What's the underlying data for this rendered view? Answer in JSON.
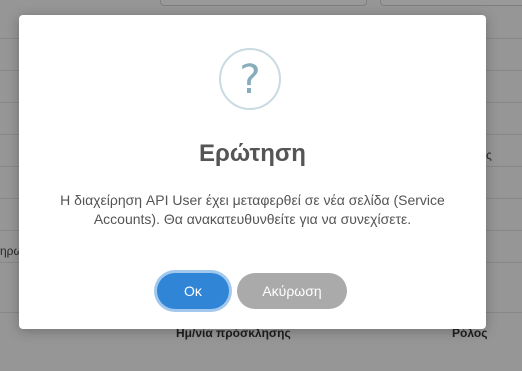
{
  "background": {
    "partial_left_text": "ηρω",
    "partial_right_text": "ς",
    "table_headers": [
      "Ημ/νία πρόσκλησης",
      "Ρόλος"
    ]
  },
  "dialog": {
    "icon": "?",
    "icon_name": "question-icon",
    "title": "Ερώτηση",
    "message": "Η διαχείρηση API User έχει μεταφερθεί σε νέα σελίδα (Service Accounts). Θα ανακατευθυνθείτε για να συνεχίσετε.",
    "ok_label": "Οκ",
    "cancel_label": "Ακύρωση"
  },
  "colors": {
    "ok_button": "#3085d6",
    "cancel_button": "#aaaaaa",
    "icon": "#87adbd"
  }
}
